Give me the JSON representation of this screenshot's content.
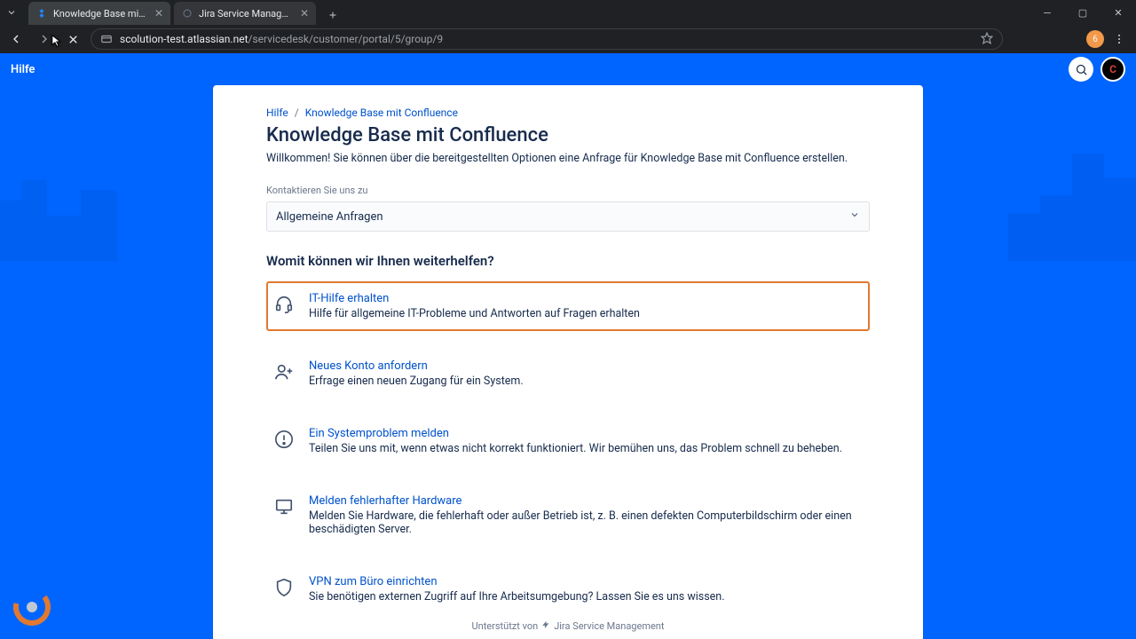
{
  "browser": {
    "tabs": [
      {
        "label": "Knowledge Base mit Confluenc",
        "active": true
      },
      {
        "label": "Jira Service Management",
        "active": false
      }
    ],
    "url_domain": "scolution-test.atlassian.net",
    "url_path": "/servicedesk/customer/portal/5/group/9",
    "profile_letter": "6"
  },
  "header": {
    "help_label": "Hilfe",
    "avatar_letter": "C"
  },
  "breadcrumb": {
    "root": "Hilfe",
    "current": "Knowledge Base mit Confluence"
  },
  "page": {
    "title": "Knowledge Base mit Confluence",
    "description": "Willkommen! Sie können über die bereitgestellten Optionen eine Anfrage für Knowledge Base mit Confluence erstellen."
  },
  "contact_select": {
    "label": "Kontaktieren Sie uns zu",
    "value": "Allgemeine Anfragen"
  },
  "help_section": {
    "title": "Womit können wir Ihnen weiterhelfen?"
  },
  "requests": [
    {
      "title": "IT-Hilfe erhalten",
      "desc": "Hilfe für allgemeine IT-Probleme und Antworten auf Fragen erhalten",
      "icon": "headset",
      "highlight": true
    },
    {
      "title": "Neues Konto anfordern",
      "desc": "Erfrage einen neuen Zugang für ein System.",
      "icon": "user-plus",
      "highlight": false
    },
    {
      "title": "Ein Systemproblem melden",
      "desc": "Teilen Sie uns mit, wenn etwas nicht korrekt funktioniert. Wir bemühen uns, das Problem schnell zu beheben.",
      "icon": "alert",
      "highlight": false
    },
    {
      "title": "Melden fehlerhafter Hardware",
      "desc": "Melden Sie Hardware, die fehlerhaft oder außer Betrieb ist, z. B. einen defekten Computerbildschirm oder einen beschädigten Server.",
      "icon": "monitor",
      "highlight": false
    },
    {
      "title": "VPN zum Büro einrichten",
      "desc": "Sie benötigen externen Zugriff auf Ihre Arbeitsumgebung? Lassen Sie es uns wissen.",
      "icon": "shield",
      "highlight": false
    }
  ],
  "footer": {
    "prefix": "Unterstützt von",
    "product": "Jira Service Management"
  }
}
